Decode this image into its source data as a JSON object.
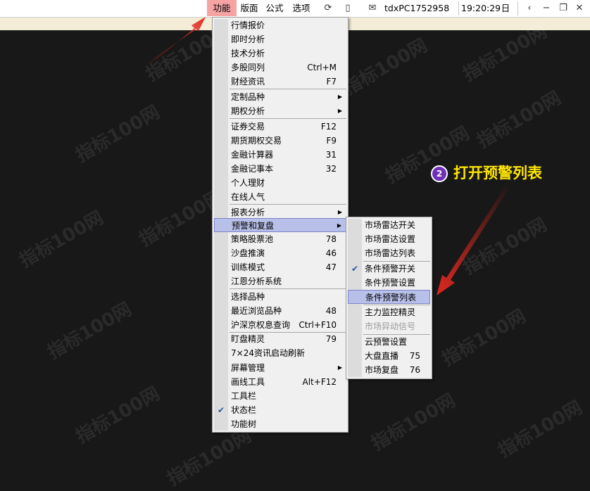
{
  "topbar": {
    "menus": [
      {
        "label": "功能",
        "active": true
      },
      {
        "label": "版面",
        "active": false
      },
      {
        "label": "公式",
        "active": false
      },
      {
        "label": "选项",
        "active": false
      }
    ],
    "icons": [
      "sync-icon",
      "phone-icon",
      "mail-icon"
    ],
    "account": "tdxPC1752958",
    "time": "19:20:29",
    "day": "日",
    "window_icons": [
      "back-icon",
      "minimize-icon",
      "restore-icon",
      "close-icon"
    ]
  },
  "main_menu": {
    "items": [
      {
        "label": "行情报价",
        "shortcut": ""
      },
      {
        "label": "即时分析",
        "shortcut": ""
      },
      {
        "label": "技术分析",
        "shortcut": ""
      },
      {
        "label": "多股同列",
        "shortcut": "Ctrl+M"
      },
      {
        "label": "财经资讯",
        "shortcut": "F7"
      },
      {
        "label": "定制品种",
        "shortcut": "",
        "submenu": true
      },
      {
        "label": "期权分析",
        "shortcut": "",
        "submenu": true
      },
      {
        "label": "证券交易",
        "shortcut": "F12"
      },
      {
        "label": "期货期权交易",
        "shortcut": "F9"
      },
      {
        "label": "金融计算器",
        "shortcut": "31"
      },
      {
        "label": "金融记事本",
        "shortcut": "32"
      },
      {
        "label": "个人理财",
        "shortcut": ""
      },
      {
        "label": "在线人气",
        "shortcut": ""
      },
      {
        "label": "报表分析",
        "shortcut": "",
        "submenu": true
      },
      {
        "label": "预警和复盘",
        "shortcut": "",
        "submenu": true,
        "highlighted": true
      },
      {
        "label": "策略股票池",
        "shortcut": "78"
      },
      {
        "label": "沙盘推演",
        "shortcut": "46"
      },
      {
        "label": "训练模式",
        "shortcut": "47"
      },
      {
        "label": "江恩分析系统",
        "shortcut": ""
      },
      {
        "label": "选择品种",
        "shortcut": ""
      },
      {
        "label": "最近浏览品种",
        "shortcut": "48"
      },
      {
        "label": "沪深京权息查询",
        "shortcut": "Ctrl+F10"
      },
      {
        "label": "盯盘精灵",
        "shortcut": "79"
      },
      {
        "label": "7×24资讯启动刷新",
        "shortcut": ""
      },
      {
        "label": "屏幕管理",
        "shortcut": "",
        "submenu": true
      },
      {
        "label": "画线工具",
        "shortcut": "Alt+F12"
      },
      {
        "label": "工具栏",
        "shortcut": ""
      },
      {
        "label": "状态栏",
        "shortcut": "",
        "checked": true
      },
      {
        "label": "功能树",
        "shortcut": ""
      }
    ]
  },
  "sub_menu": {
    "items": [
      {
        "label": "市场雷达开关",
        "shortcut": ""
      },
      {
        "label": "市场雷达设置",
        "shortcut": ""
      },
      {
        "label": "市场雷达列表",
        "shortcut": ""
      },
      {
        "label": "条件预警开关",
        "shortcut": "",
        "checked": true
      },
      {
        "label": "条件预警设置",
        "shortcut": ""
      },
      {
        "label": "条件预警列表",
        "shortcut": "",
        "highlighted": true
      },
      {
        "label": "主力监控精灵",
        "shortcut": ""
      },
      {
        "label": "市场异动信号",
        "shortcut": "",
        "disabled": true
      },
      {
        "label": "云预警设置",
        "shortcut": ""
      },
      {
        "label": "大盘直播",
        "shortcut": "75"
      },
      {
        "label": "市场复盘",
        "shortcut": "76"
      }
    ]
  },
  "annotation": {
    "step": "2",
    "text": "打开预警列表"
  },
  "watermark": "指标100网",
  "colors": {
    "arrow": "#e0281f",
    "annotation": "#ffe600",
    "badge": "#6f2fb8",
    "highlight": "#b8bfe8"
  }
}
